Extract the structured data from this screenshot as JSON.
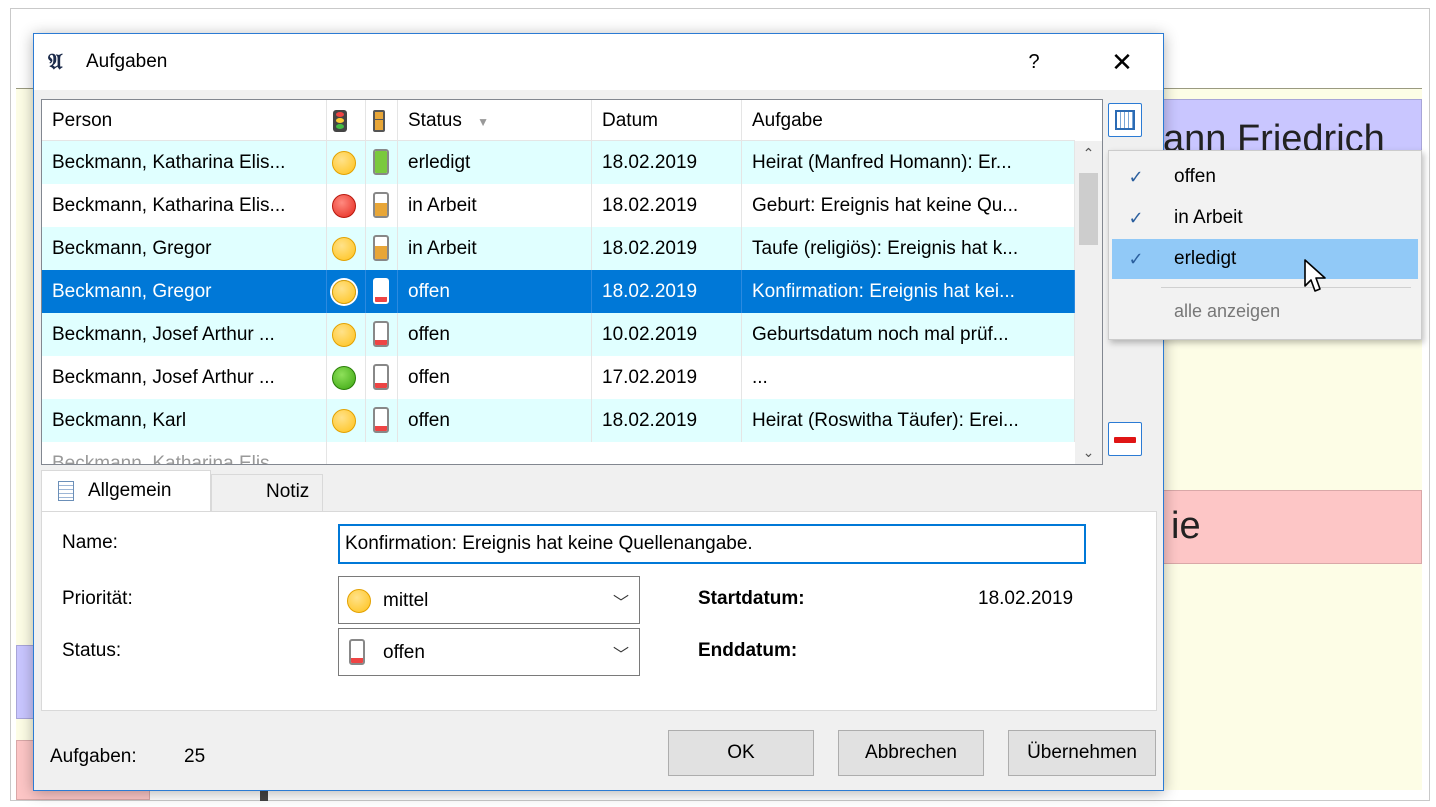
{
  "background": {
    "box_top_right": "ann Friedrich",
    "box_mid_right": "ie"
  },
  "dialog": {
    "title": "Aufgaben",
    "help_label": "?",
    "close_label": "✕"
  },
  "list": {
    "headers": {
      "person": "Person",
      "status": "Status",
      "status_sort_glyph": "▼",
      "date": "Datum",
      "task": "Aufgabe"
    },
    "rows": [
      {
        "person": "Beckmann, Katharina Elis...",
        "priority": "yellow",
        "battery": "full",
        "status": "erledigt",
        "date": "18.02.2019",
        "task": "Heirat (Manfred Homann): Er..."
      },
      {
        "person": "Beckmann, Katharina Elis...",
        "priority": "red",
        "battery": "half",
        "status": "in Arbeit",
        "date": "18.02.2019",
        "task": "Geburt: Ereignis hat keine Qu..."
      },
      {
        "person": "Beckmann, Gregor",
        "priority": "yellow",
        "battery": "half",
        "status": "in Arbeit",
        "date": "18.02.2019",
        "task": "Taufe (religiös): Ereignis hat k..."
      },
      {
        "person": "Beckmann, Gregor",
        "priority": "yellow",
        "battery": "empty",
        "status": "offen",
        "date": "18.02.2019",
        "task": "Konfirmation: Ereignis hat kei..."
      },
      {
        "person": "Beckmann, Josef Arthur ...",
        "priority": "yellow",
        "battery": "empty",
        "status": "offen",
        "date": "10.02.2019",
        "task": "Geburtsdatum noch mal prüf..."
      },
      {
        "person": "Beckmann, Josef Arthur ...",
        "priority": "green",
        "battery": "empty",
        "status": "offen",
        "date": "17.02.2019",
        "task": "..."
      },
      {
        "person": "Beckmann, Karl",
        "priority": "yellow",
        "battery": "empty",
        "status": "offen",
        "date": "18.02.2019",
        "task": "Heirat (Roswitha Täufer): Erei..."
      }
    ],
    "selected_index": 3
  },
  "tabs": {
    "general": "Allgemein",
    "note": "Notiz"
  },
  "form": {
    "name_label": "Name:",
    "name_value": "Konfirmation: Ereignis hat keine Quellenangabe.",
    "priority_label": "Priorität:",
    "priority_value": "mittel",
    "status_label": "Status:",
    "status_value": "offen",
    "start_label": "Startdatum:",
    "start_value": "18.02.2019",
    "end_label": "Enddatum:",
    "end_value": ""
  },
  "footer": {
    "count_label": "Aufgaben:",
    "count_value": "25",
    "ok": "OK",
    "cancel": "Abbrechen",
    "apply": "Übernehmen"
  },
  "filter_menu": {
    "items": [
      {
        "label": "offen",
        "checked": true
      },
      {
        "label": "in Arbeit",
        "checked": true
      },
      {
        "label": "erledigt",
        "checked": true
      }
    ],
    "highlighted_index": 2,
    "show_all": "alle anzeigen"
  }
}
